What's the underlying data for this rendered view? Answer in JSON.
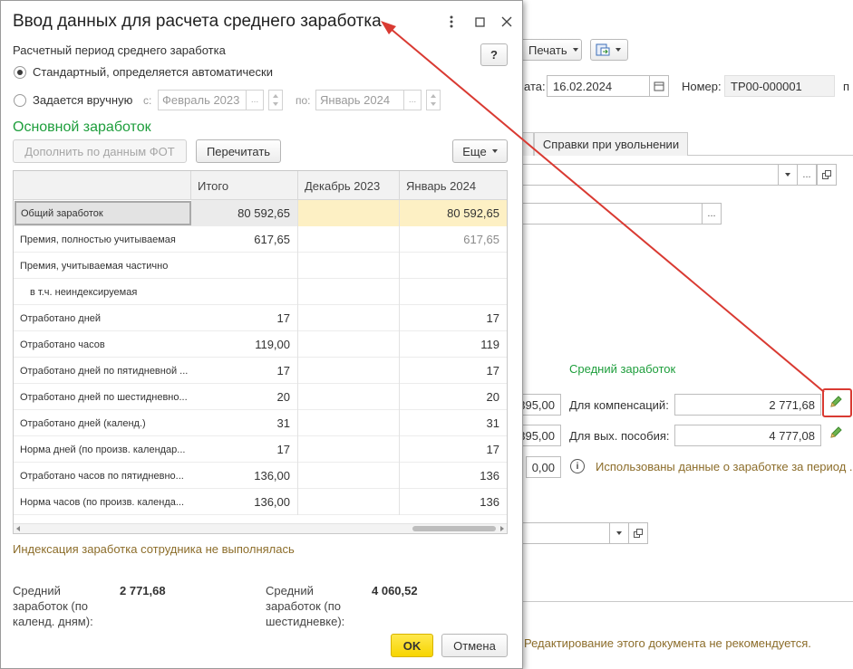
{
  "background": {
    "print_button": "Печать",
    "date_label": "ата:",
    "date_value": "16.02.2024",
    "number_label": "Номер:",
    "number_value": "ТР00-000001",
    "number_trail": "п",
    "tab_dismissal": "Справки при увольнении",
    "section_avg": "Средний заработок",
    "avg_values": [
      "395,00",
      "395,00",
      "0,00"
    ],
    "comp_label": "Для компенсаций:",
    "comp_value": "2 771,68",
    "benefit_label": "Для вых. пособия:",
    "benefit_value": "4 777,08",
    "info_text": "Использованы данные о заработке за период .",
    "warning_text": "Редактирование этого документа не рекомендуется.",
    "ellipsis": "...",
    "colors": {
      "annotation_red": "#d93a32",
      "pencil_green": "#3b8a2e"
    }
  },
  "dialog": {
    "title": "Ввод данных для расчета среднего заработка",
    "help_label": "?",
    "period_label": "Расчетный период среднего заработка",
    "radio_standard": "Стандартный, определяется автоматически",
    "radio_manual": "Задается вручную",
    "from_label": "с:",
    "from_value": "Февраль 2023",
    "to_label": "по:",
    "to_value": "Январь 2024",
    "ellipsis": "...",
    "section_title": "Основной заработок",
    "btn_fill": "Дополнить по данным ФОТ",
    "btn_recalc": "Перечитать",
    "btn_more": "Еще",
    "grid": {
      "headers": [
        "",
        "Итого",
        "Декабрь 2023",
        "Январь 2024"
      ],
      "rows": [
        {
          "name": "Общий заработок",
          "itogo": "80 592,65",
          "dec": "",
          "jan": "80 592,65"
        },
        {
          "name": "Премия, полностью учитываемая",
          "itogo": "617,65",
          "dec": "",
          "jan": "617,65"
        },
        {
          "name": "Премия, учитываемая частично",
          "itogo": "",
          "dec": "",
          "jan": ""
        },
        {
          "name": "в т.ч. неиндексируемая",
          "itogo": "",
          "dec": "",
          "jan": ""
        },
        {
          "name": "Отработано дней",
          "itogo": "17",
          "dec": "",
          "jan": "17"
        },
        {
          "name": "Отработано часов",
          "itogo": "119,00",
          "dec": "",
          "jan": "119"
        },
        {
          "name": "Отработано дней по пятидневной ...",
          "itogo": "17",
          "dec": "",
          "jan": "17"
        },
        {
          "name": "Отработано дней по шестидневно...",
          "itogo": "20",
          "dec": "",
          "jan": "20"
        },
        {
          "name": "Отработано дней (календ.)",
          "itogo": "31",
          "dec": "",
          "jan": "31"
        },
        {
          "name": "Норма дней (по произв. календар...",
          "itogo": "17",
          "dec": "",
          "jan": "17"
        },
        {
          "name": "Отработано часов по пятидневно...",
          "itogo": "136,00",
          "dec": "",
          "jan": "136"
        },
        {
          "name": "Норма часов (по произв. календа...",
          "itogo": "136,00",
          "dec": "",
          "jan": "136"
        }
      ]
    },
    "index_note": "Индексация заработка сотрудника не выполнялась",
    "avg_calendar_label": "Средний\nзаработок (по\nкаленд. дням):",
    "avg_calendar_value": "2 771,68",
    "avg_six_label": "Средний\nзаработок (по\nшестидневке):",
    "avg_six_value": "4 060,52",
    "ok_label": "OK",
    "cancel_label": "Отмена",
    "colors": {
      "section_green": "#1e9e3c",
      "note_brown": "#8c6d2a",
      "ok_yellow": "#f7d500",
      "highlight_row": "#fdf0c4"
    }
  }
}
